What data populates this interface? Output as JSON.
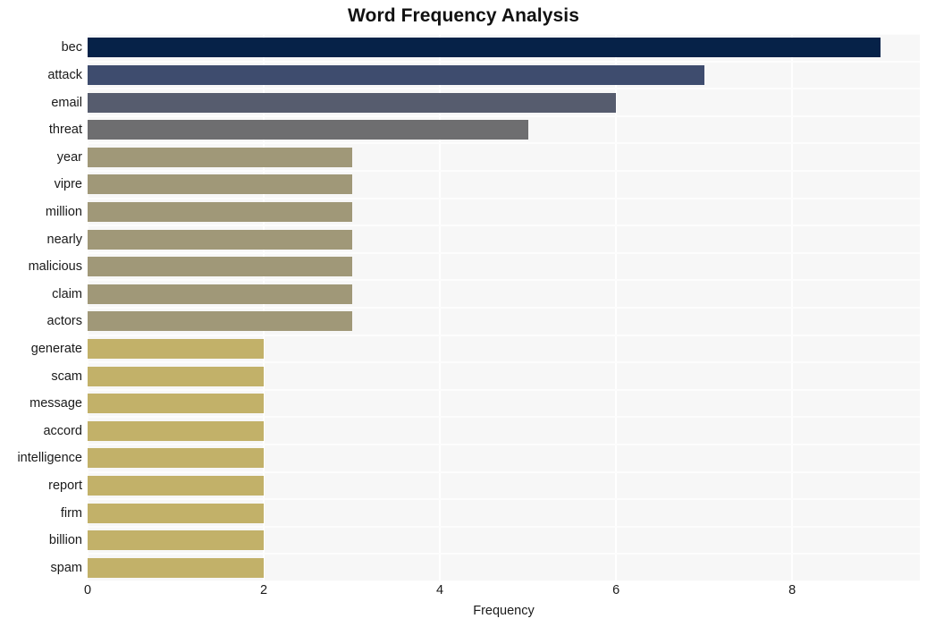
{
  "chart_data": {
    "type": "bar",
    "orientation": "horizontal",
    "title": "Word Frequency Analysis",
    "xlabel": "Frequency",
    "ylabel": "",
    "xlim": [
      0,
      9.45
    ],
    "xticks": [
      "0",
      "2",
      "4",
      "6",
      "8"
    ],
    "xtick_values": [
      0,
      2,
      4,
      6,
      8
    ],
    "grid": true,
    "legend": "none",
    "categories": [
      "bec",
      "attack",
      "email",
      "threat",
      "year",
      "vipre",
      "million",
      "nearly",
      "malicious",
      "claim",
      "actors",
      "generate",
      "scam",
      "message",
      "accord",
      "intelligence",
      "report",
      "firm",
      "billion",
      "spam"
    ],
    "values": [
      9,
      7,
      6,
      5,
      3,
      3,
      3,
      3,
      3,
      3,
      3,
      2,
      2,
      2,
      2,
      2,
      2,
      2,
      2,
      2
    ],
    "bar_colors": [
      "#062248",
      "#3e4c6e",
      "#565c6e",
      "#6e6e70",
      "#a09878",
      "#a09878",
      "#a09878",
      "#a09878",
      "#a09878",
      "#a09878",
      "#a09878",
      "#c2b169",
      "#c2b169",
      "#c2b169",
      "#c2b169",
      "#c2b169",
      "#c2b169",
      "#c2b169",
      "#c2b169",
      "#c2b169"
    ],
    "plot_background": "#f7f7f7",
    "gridline_color": "#ffffff",
    "text_color": "#1a1a1a"
  }
}
